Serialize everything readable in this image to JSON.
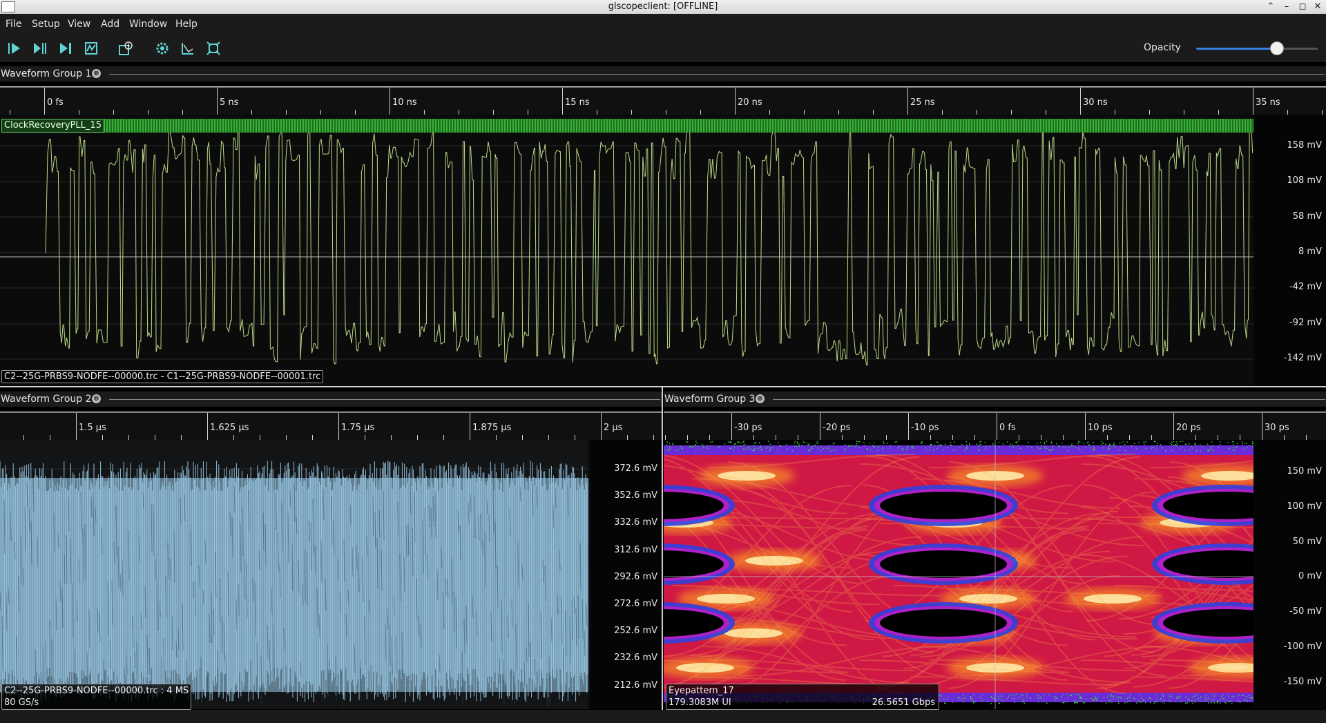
{
  "window": {
    "title": "glscopeclient: [OFFLINE]",
    "controls": [
      "⌃",
      "–",
      "◻",
      "✕"
    ]
  },
  "menu": [
    "File",
    "Setup",
    "View",
    "Add",
    "Window",
    "Help"
  ],
  "toolbar": {
    "buttons": [
      {
        "icon": "start-trigger-icon"
      },
      {
        "icon": "single-trigger-icon"
      },
      {
        "icon": "force-trigger-icon"
      },
      {
        "icon": "stop-trigger-icon"
      },
      {
        "icon": "history-icon"
      },
      {
        "icon": "refresh-settings-icon"
      },
      {
        "icon": "clear-sweeps-icon"
      },
      {
        "icon": "fullscreen-icon"
      }
    ],
    "opacity_label": "Opacity",
    "opacity_value": 0.67,
    "accent": "#3584e4"
  },
  "group1": {
    "title": "Waveform Group 1",
    "close": "⊗",
    "ticks": [
      "0 fs",
      "5 ns",
      "10 ns",
      "15 ns",
      "20 ns",
      "25 ns",
      "30 ns",
      "35 ns"
    ],
    "protocol_label": "ClockRecoveryPLL_15",
    "y_labels": [
      "158 mV",
      "108 mV",
      "58 mV",
      "8 mV",
      "-42 mV",
      "-92 mV",
      "-142 mV"
    ],
    "channel_label": "C2--25G-PRBS9-NODFE--00000.trc - C1--25G-PRBS9-NODFE--00001.trc",
    "trace_color": "#c6e68e"
  },
  "group2": {
    "title": "Waveform Group 2",
    "close": "⊗",
    "ticks": [
      "1.5 µs",
      "1.625 µs",
      "1.75 µs",
      "1.875 µs",
      "2 µs"
    ],
    "y_labels": [
      "372.6 mV",
      "352.6 mV",
      "332.6 mV",
      "312.6 mV",
      "292.6 mV",
      "272.6 mV",
      "252.6 mV",
      "232.6 mV",
      "212.6 mV"
    ],
    "channel_line1": "C2--25G-PRBS9-NODFE--00000.trc : 4 MS",
    "channel_line2": "80 GS/s",
    "trace_color": "#9fd0ef"
  },
  "group3": {
    "title": "Waveform Group 3",
    "close": "⊗",
    "ticks": [
      "-30 ps",
      "-20 ps",
      "-10 ps",
      "0 fs",
      "10 ps",
      "20 ps",
      "30 ps"
    ],
    "y_labels": [
      "150 mV",
      "100 mV",
      "50 mV",
      "0 mV",
      "-50 mV",
      "-100 mV",
      "-150 mV"
    ],
    "eye_name": "Eyepattern_17",
    "eye_ui": "179.3083M UI",
    "eye_rate": "26.5651 Gbps"
  }
}
